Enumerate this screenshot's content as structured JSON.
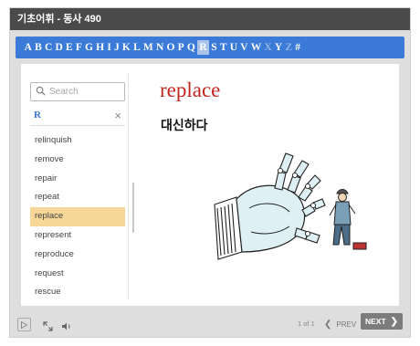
{
  "title": "기초어휘 - 동사 490",
  "alphabet": [
    {
      "letter": "A",
      "state": "normal"
    },
    {
      "letter": "B",
      "state": "normal"
    },
    {
      "letter": "C",
      "state": "normal"
    },
    {
      "letter": "D",
      "state": "normal"
    },
    {
      "letter": "E",
      "state": "normal"
    },
    {
      "letter": "F",
      "state": "normal"
    },
    {
      "letter": "G",
      "state": "normal"
    },
    {
      "letter": "H",
      "state": "normal"
    },
    {
      "letter": "I",
      "state": "normal"
    },
    {
      "letter": "J",
      "state": "normal"
    },
    {
      "letter": "K",
      "state": "normal"
    },
    {
      "letter": "L",
      "state": "normal"
    },
    {
      "letter": "M",
      "state": "normal"
    },
    {
      "letter": "N",
      "state": "normal"
    },
    {
      "letter": "O",
      "state": "normal"
    },
    {
      "letter": "P",
      "state": "normal"
    },
    {
      "letter": "Q",
      "state": "normal"
    },
    {
      "letter": "R",
      "state": "active"
    },
    {
      "letter": "S",
      "state": "normal"
    },
    {
      "letter": "T",
      "state": "normal"
    },
    {
      "letter": "U",
      "state": "normal"
    },
    {
      "letter": "V",
      "state": "normal"
    },
    {
      "letter": "W",
      "state": "normal"
    },
    {
      "letter": "X",
      "state": "disabled"
    },
    {
      "letter": "Y",
      "state": "normal"
    },
    {
      "letter": "Z",
      "state": "disabled"
    },
    {
      "letter": "#",
      "state": "normal"
    }
  ],
  "search": {
    "placeholder": "Search",
    "value": ""
  },
  "filter": {
    "letter": "R",
    "clear_label": "×"
  },
  "words": [
    "relinquish",
    "remove",
    "repair",
    "repeat",
    "replace",
    "represent",
    "reproduce",
    "request",
    "rescue"
  ],
  "selected_word": "replace",
  "detail": {
    "word": "replace",
    "meaning": "대신하다"
  },
  "controls": {
    "page_indicator": "1 of 1",
    "prev_label": "PREV",
    "next_label": "NEXT"
  },
  "colors": {
    "alphabar": "#3b7ad6",
    "active_letter": "#a9c3ea",
    "selected_row": "#f6d797",
    "word_title": "#c0271e",
    "titlebar": "#4a4a4a",
    "next_button": "#7c7c7c"
  },
  "icons": {
    "search": "search-icon",
    "play": "play-icon",
    "fullscreen": "expand-icon",
    "audio": "speaker-icon",
    "prev": "chevron-left-icon",
    "next": "chevron-right-icon"
  }
}
